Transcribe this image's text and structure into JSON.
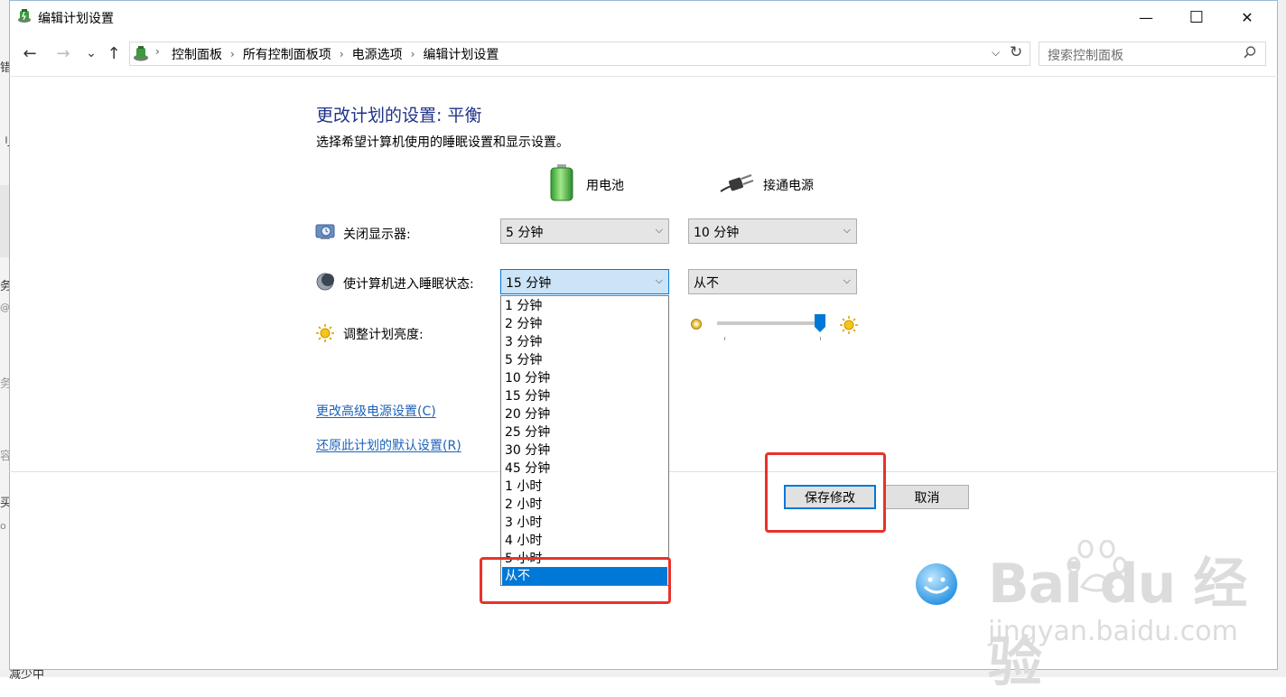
{
  "window": {
    "title": "编辑计划设置",
    "minimize_glyph": "—",
    "maximize_glyph": "☐",
    "close_glyph": "✕"
  },
  "nav": {
    "back_glyph": "←",
    "forward_glyph": "→",
    "recent_glyph": "⌄",
    "up_glyph": "↑",
    "breadcrumbs": [
      "控制面板",
      "所有控制面板项",
      "电源选项",
      "编辑计划设置"
    ],
    "search_placeholder": "搜索控制面板"
  },
  "main": {
    "heading": "更改计划的设置: 平衡",
    "subtitle": "选择希望计算机使用的睡眠设置和显示设置。",
    "columns": {
      "battery": "用电池",
      "plugged_in": "接通电源"
    },
    "rows": {
      "display_off": {
        "label": "关闭显示器:",
        "battery": "5 分钟",
        "plugged_in": "10 分钟"
      },
      "sleep": {
        "label": "使计算机进入睡眠状态:",
        "battery": "15 分钟",
        "plugged_in": "从不"
      },
      "brightness": {
        "label": "调整计划亮度:",
        "plugged_in_level": 1.0
      }
    },
    "links": {
      "advanced": "更改高级电源设置(C)",
      "advanced_text": "更改高级电源设置(",
      "advanced_key": "C",
      "advanced_end": ")",
      "restore_text": "还原此计划的默认设置(",
      "restore_key": "R",
      "restore_end": ")"
    },
    "dropdown_options": [
      "1 分钟",
      "2 分钟",
      "3 分钟",
      "5 分钟",
      "10 分钟",
      "15 分钟",
      "20 分钟",
      "25 分钟",
      "30 分钟",
      "45 分钟",
      "1 小时",
      "2 小时",
      "3 小时",
      "4 小时",
      "5 小时",
      "从不"
    ],
    "dropdown_selected": "从不",
    "buttons": {
      "save": "保存修改",
      "cancel": "取消"
    }
  },
  "background_window": {
    "fragments": [
      "错",
      "刂",
      "务",
      "@",
      "务",
      "容",
      "买",
      "o",
      "减少中"
    ]
  },
  "watermark": {
    "brand": "Bai du 经验",
    "url": "jingyan.baidu.com"
  },
  "colors": {
    "heading": "#1e3287",
    "link": "#1c62b9",
    "selection": "#0078d7",
    "highlight_box": "#e8322c"
  },
  "icons": [
    "power-plan-icon",
    "battery-icon",
    "plug-icon",
    "display-icon",
    "sleep-moon-icon",
    "brightness-icon",
    "refresh-icon",
    "search-icon",
    "chevron-down-icon",
    "brightness-low-icon",
    "brightness-high-icon"
  ]
}
